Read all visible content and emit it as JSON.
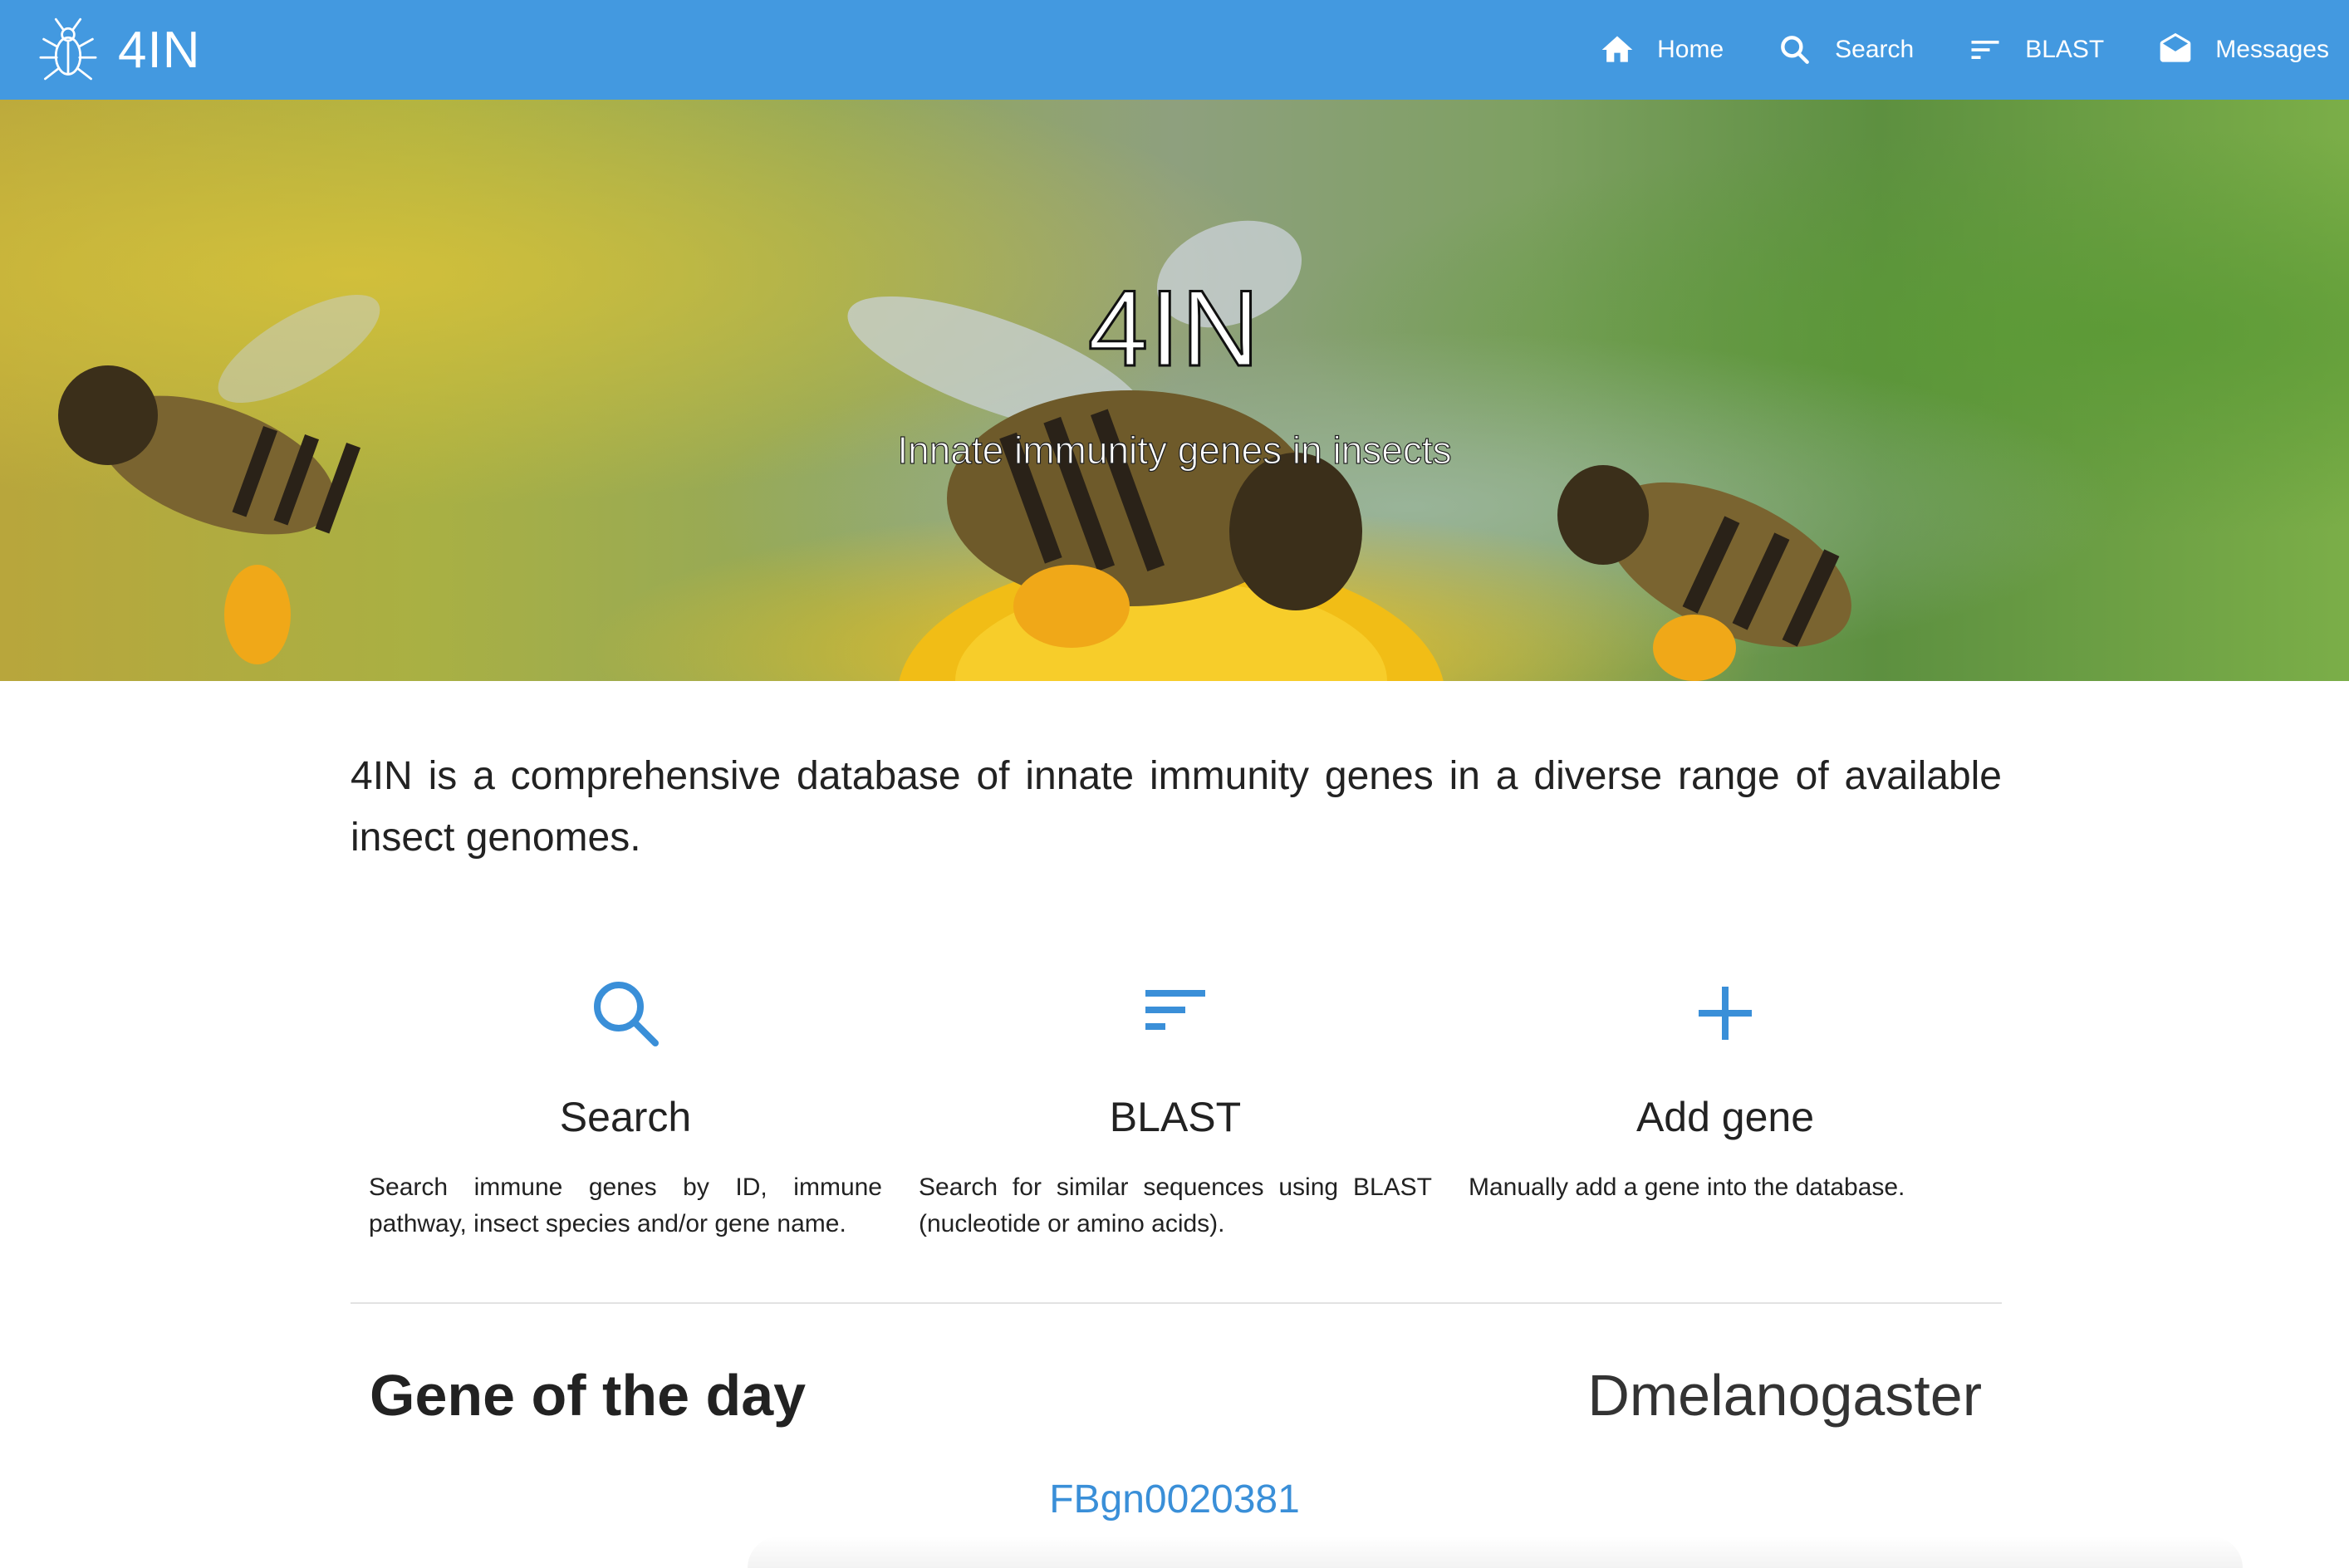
{
  "navbar": {
    "brand": "4IN",
    "brand_icon": "insect-logo-icon",
    "links": [
      {
        "label": "Home",
        "icon": "home-icon"
      },
      {
        "label": "Search",
        "icon": "search-icon"
      },
      {
        "label": "BLAST",
        "icon": "blast-sort-icon"
      },
      {
        "label": "Messages",
        "icon": "envelope-icon"
      }
    ]
  },
  "hero": {
    "title": "4IN",
    "subtitle": "Innate immunity genes in insects"
  },
  "intro": "4IN is a comprehensive database of innate immunity genes in a diverse range of available insect genomes.",
  "features": [
    {
      "title": "Search",
      "icon": "search-icon",
      "description": "Search immune genes by ID, immune pathway, insect species and/or gene name."
    },
    {
      "title": "BLAST",
      "icon": "blast-sort-icon",
      "description": "Search for similar sequences using BLAST (nucleotide or amino acids)."
    },
    {
      "title": "Add gene",
      "icon": "plus-icon",
      "description": "Manually add a gene into the database."
    }
  ],
  "gene_of_the_day": {
    "title": "Gene of the day",
    "species": "Dmelanogaster",
    "gene_id": "FBgn0020381"
  },
  "colors": {
    "navbar": "#4399e0",
    "accent": "#3a8fd8",
    "text": "#222222"
  }
}
